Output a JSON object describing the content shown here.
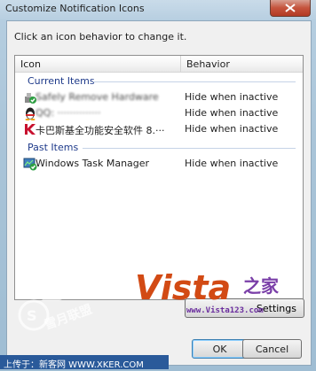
{
  "window": {
    "title": "Customize Notification Icons"
  },
  "dialog": {
    "instruction": "Click an icon behavior to change it."
  },
  "list": {
    "columns": {
      "icon": "Icon",
      "behavior": "Behavior"
    },
    "groups": [
      {
        "title": "Current Items",
        "items": [
          {
            "name": "Safely Remove Hardware",
            "behavior": "Hide when inactive",
            "icon": "safely-remove-hardware-icon"
          },
          {
            "name": "QQ: ··············",
            "behavior": "Hide when inactive",
            "icon": "qq-penguin-icon"
          },
          {
            "name": "卡巴斯基全功能安全软件 8.···",
            "behavior": "Hide when inactive",
            "icon": "kaspersky-k-icon"
          }
        ]
      },
      {
        "title": "Past Items",
        "items": [
          {
            "name": "Windows Task Manager",
            "behavior": "Hide when inactive",
            "icon": "task-manager-icon"
          }
        ]
      }
    ]
  },
  "buttons": {
    "settings": "Settings",
    "ok": "OK",
    "cancel": "Cancel"
  },
  "watermark": {
    "logo_main": "Vista",
    "logo_suffix": "之家",
    "url": "www.Vista123.com",
    "left_text": "雪月联盟",
    "bottom": "上传于：新客网 WWW.XKER.COM"
  },
  "colors": {
    "accent": "#3c7fb1",
    "group_title": "#1e3a8a",
    "close_red": "#c5533c"
  }
}
